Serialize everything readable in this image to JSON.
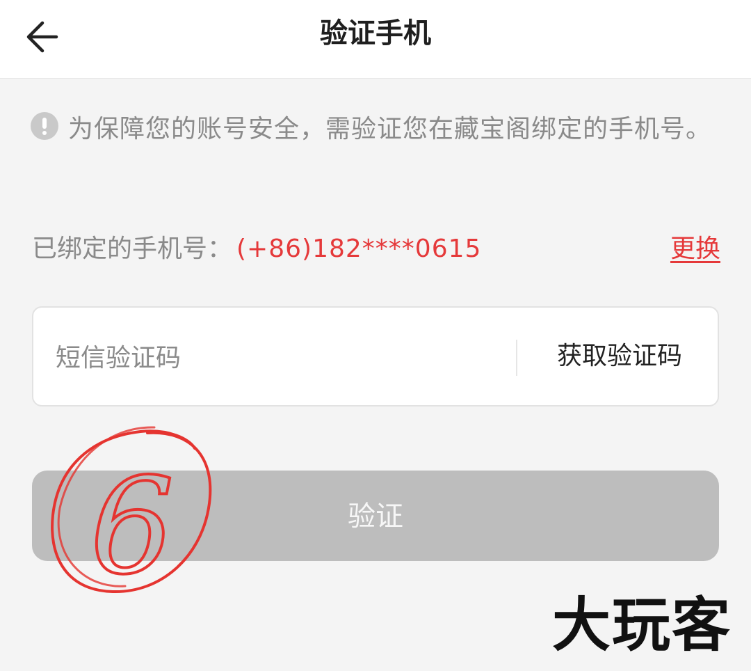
{
  "header": {
    "title": "验证手机",
    "back_icon": "arrow-left-icon"
  },
  "notice": {
    "icon": "exclamation-circle-icon",
    "text": "为保障您的账号安全，需验证您在藏宝阁绑定的手机号。"
  },
  "phone": {
    "label": "已绑定的手机号：",
    "number": "(+86)182****0615",
    "change_label": "更换"
  },
  "code_field": {
    "placeholder": "短信验证码",
    "value": "",
    "get_code_label": "获取验证码"
  },
  "verify_button": {
    "label": "验证"
  },
  "annotation": {
    "text": "6"
  },
  "watermark": {
    "text": "大玩客"
  },
  "colors": {
    "accent_red": "#e5393a",
    "button_disabled": "#bdbdbd",
    "background": "#f4f4f4"
  }
}
